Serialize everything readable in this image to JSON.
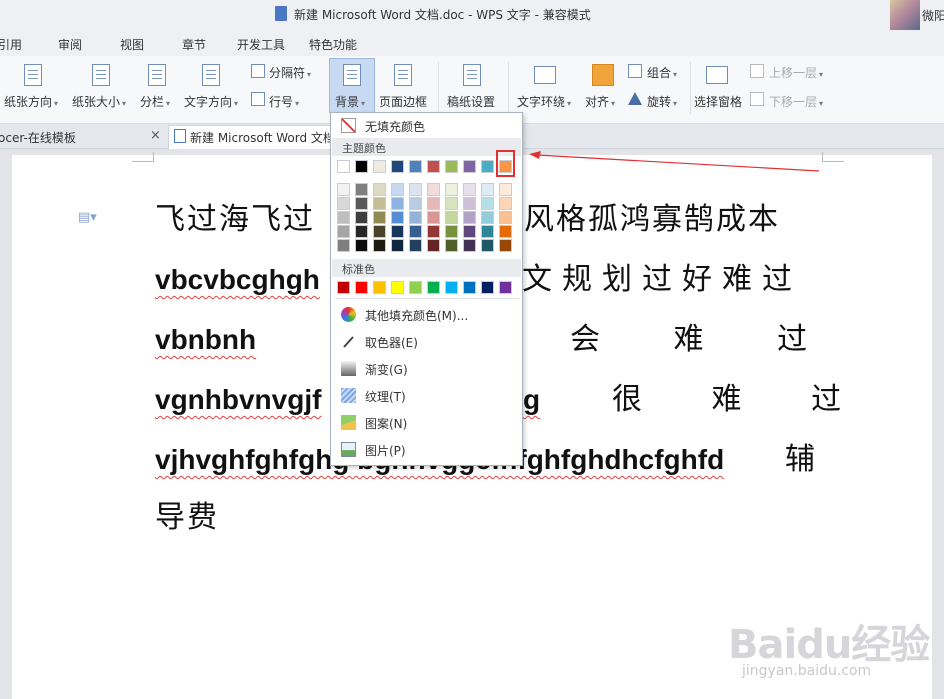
{
  "title_bar": {
    "title": "新建 Microsoft Word 文档.doc - WPS 文字 - 兼容模式",
    "user": "微阳"
  },
  "menu_tabs": [
    {
      "label": "引用",
      "active": false
    },
    {
      "label": "审阅",
      "active": false
    },
    {
      "label": "视图",
      "active": false
    },
    {
      "label": "章节",
      "active": false
    },
    {
      "label": "开发工具",
      "active": false
    },
    {
      "label": "特色功能",
      "active": false
    }
  ],
  "ribbon": {
    "paper_orientation": "纸张方向",
    "paper_size": "纸张大小",
    "columns": "分栏",
    "text_direction": "文字方向",
    "separator": "分隔符",
    "line_number": "行号",
    "background": "背景",
    "page_border": "页面边框",
    "draft_setting": "稿纸设置",
    "text_wrap": "文字环绕",
    "align": "对齐",
    "group": "组合",
    "rotate": "旋转",
    "selection_pane": "选择窗格",
    "bring_forward": "上移一层",
    "send_backward": "下移一层"
  },
  "doc_tabs": [
    {
      "label": "ocer-在线模板",
      "active": false
    },
    {
      "label": "新建 Microsoft Word 文档",
      "active": true
    }
  ],
  "document": {
    "lines": [
      {
        "cjk1": "飞过海飞过",
        "bold": "",
        "cjk2": "风格孤鸿寡鹄成本"
      },
      {
        "cjk1": "",
        "bold": "vbcvbcghgh",
        "cjk2": "文规划过好难过"
      },
      {
        "cjk1": "",
        "bold": "vbnbnh",
        "cjk2": "会 难 过"
      },
      {
        "cjk1": "",
        "bold": "vgnhbvnvgjf",
        "cjk2": "很 难 过"
      },
      {
        "cjk1": "",
        "bold": "vjhvghfghfghg bghhvggcfhfghfghdhcfghfd",
        "cjk2": "辅"
      },
      {
        "cjk1": "导费",
        "bold": "",
        "cjk2": ""
      }
    ]
  },
  "background_menu": {
    "no_fill": "无填充颜色",
    "theme_colors_header": "主题颜色",
    "theme_row": [
      "#ffffff",
      "#000000",
      "#eeece1",
      "#1f497d",
      "#4f81bd",
      "#c0504d",
      "#9bbb59",
      "#8064a2",
      "#4bacc6",
      "#f79646"
    ],
    "theme_shades": [
      [
        "#f2f2f2",
        "#7f7f7f",
        "#ddd9c3",
        "#c6d9f0",
        "#dbe5f1",
        "#f2dcdb",
        "#ebf1dd",
        "#e5e0ec",
        "#dbeef3",
        "#fdeada"
      ],
      [
        "#d8d8d8",
        "#595959",
        "#c4bd97",
        "#8db3e2",
        "#b8cce4",
        "#e5b9b7",
        "#d7e3bc",
        "#ccc1d9",
        "#b7dde8",
        "#fbd5b5"
      ],
      [
        "#bfbfbf",
        "#3f3f3f",
        "#938953",
        "#548dd4",
        "#95b3d7",
        "#d99694",
        "#c3d69b",
        "#b2a2c7",
        "#92cddc",
        "#fac08f"
      ],
      [
        "#a5a5a5",
        "#262626",
        "#494429",
        "#17365d",
        "#366092",
        "#953734",
        "#76923c",
        "#5f497a",
        "#31859b",
        "#e36c09"
      ],
      [
        "#7f7f7f",
        "#0c0c0c",
        "#1d1b10",
        "#0f243e",
        "#244061",
        "#632423",
        "#4f6128",
        "#3f3151",
        "#205867",
        "#974806"
      ]
    ],
    "standard_colors_header": "标准色",
    "standard_row": [
      "#c00000",
      "#ff0000",
      "#ffc000",
      "#ffff00",
      "#92d050",
      "#00b050",
      "#00b0f0",
      "#0070c0",
      "#002060",
      "#7030a0"
    ],
    "more_colors": "其他填充颜色(M)...",
    "eyedropper": "取色器(E)",
    "gradient": "渐变(G)",
    "texture": "纹理(T)",
    "pattern": "图案(N)",
    "picture": "图片(P)"
  },
  "watermark": {
    "brand": "Baidu经验",
    "url": "jingyan.baidu.com"
  },
  "colors": {
    "annotation": "#e03030",
    "ribbon_active": "#c8daf1"
  }
}
